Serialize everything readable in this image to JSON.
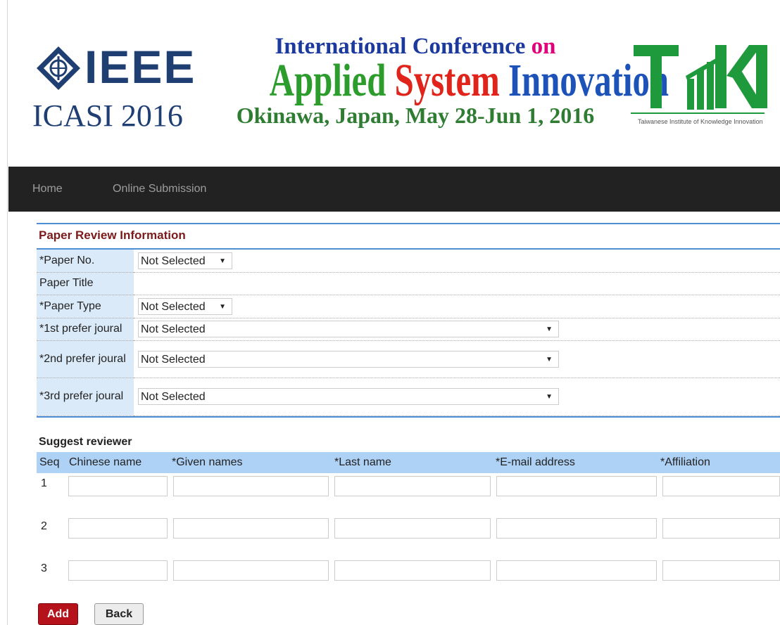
{
  "banner": {
    "ieee_word": "IEEE",
    "ieee_event": "ICASI 2016",
    "conf_line1_a": "International Conference ",
    "conf_line1_on": "on",
    "conf_applied": "Applied ",
    "conf_system": "System ",
    "conf_innovation": "Innovation",
    "conf_location": "Okinawa, Japan, May 28-Jun 1, 2016",
    "taki_word": "TAKI",
    "taki_caption": "Taiwanese Institute of Knowledge Innovation"
  },
  "nav": {
    "home": "Home",
    "online_submission": "Online Submission"
  },
  "form": {
    "title": "Paper Review Information",
    "rows": [
      {
        "label": "*Paper No.",
        "value": "Not Selected"
      },
      {
        "label": "Paper Title",
        "value": ""
      },
      {
        "label": "*Paper Type",
        "value": "Not Selected"
      },
      {
        "label": "*1st prefer joural",
        "value": "Not Selected"
      },
      {
        "label": "*2nd prefer joural",
        "value": "Not Selected"
      },
      {
        "label": "*3rd prefer joural",
        "value": "Not Selected"
      }
    ]
  },
  "reviewers": {
    "title": "Suggest reviewer",
    "columns": [
      "Seq",
      "Chinese name",
      "*Given names",
      "*Last name",
      "*E-mail address",
      "*Affiliation"
    ],
    "rows": [
      {
        "seq": "1"
      },
      {
        "seq": "2"
      },
      {
        "seq": "3"
      }
    ]
  },
  "buttons": {
    "add": "Add",
    "back": "Back"
  },
  "colors": {
    "navbar_bg": "#222222",
    "nav_text": "#9d9d9d",
    "label_bg": "#dbeaf9",
    "header_bg": "#aed1f6",
    "panel_border": "#4d8fd6",
    "title_color": "#7a1a1a",
    "add_button": "#b5121b"
  }
}
